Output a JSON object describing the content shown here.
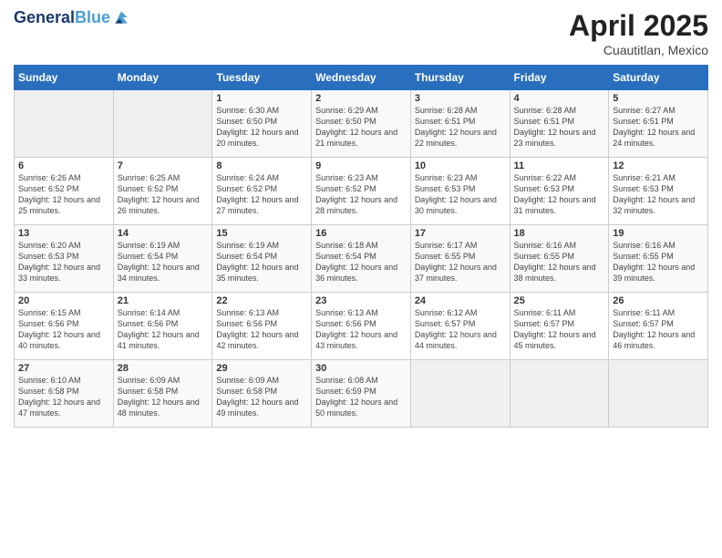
{
  "header": {
    "logo_line1": "General",
    "logo_line2": "Blue",
    "month": "April 2025",
    "location": "Cuautitlan, Mexico"
  },
  "days_of_week": [
    "Sunday",
    "Monday",
    "Tuesday",
    "Wednesday",
    "Thursday",
    "Friday",
    "Saturday"
  ],
  "weeks": [
    [
      {
        "day": "",
        "empty": true
      },
      {
        "day": "",
        "empty": true
      },
      {
        "day": "1",
        "sunrise": "6:30 AM",
        "sunset": "6:50 PM",
        "daylight": "12 hours and 20 minutes."
      },
      {
        "day": "2",
        "sunrise": "6:29 AM",
        "sunset": "6:50 PM",
        "daylight": "12 hours and 21 minutes."
      },
      {
        "day": "3",
        "sunrise": "6:28 AM",
        "sunset": "6:51 PM",
        "daylight": "12 hours and 22 minutes."
      },
      {
        "day": "4",
        "sunrise": "6:28 AM",
        "sunset": "6:51 PM",
        "daylight": "12 hours and 23 minutes."
      },
      {
        "day": "5",
        "sunrise": "6:27 AM",
        "sunset": "6:51 PM",
        "daylight": "12 hours and 24 minutes."
      }
    ],
    [
      {
        "day": "6",
        "sunrise": "6:26 AM",
        "sunset": "6:52 PM",
        "daylight": "12 hours and 25 minutes."
      },
      {
        "day": "7",
        "sunrise": "6:25 AM",
        "sunset": "6:52 PM",
        "daylight": "12 hours and 26 minutes."
      },
      {
        "day": "8",
        "sunrise": "6:24 AM",
        "sunset": "6:52 PM",
        "daylight": "12 hours and 27 minutes."
      },
      {
        "day": "9",
        "sunrise": "6:23 AM",
        "sunset": "6:52 PM",
        "daylight": "12 hours and 28 minutes."
      },
      {
        "day": "10",
        "sunrise": "6:23 AM",
        "sunset": "6:53 PM",
        "daylight": "12 hours and 30 minutes."
      },
      {
        "day": "11",
        "sunrise": "6:22 AM",
        "sunset": "6:53 PM",
        "daylight": "12 hours and 31 minutes."
      },
      {
        "day": "12",
        "sunrise": "6:21 AM",
        "sunset": "6:53 PM",
        "daylight": "12 hours and 32 minutes."
      }
    ],
    [
      {
        "day": "13",
        "sunrise": "6:20 AM",
        "sunset": "6:53 PM",
        "daylight": "12 hours and 33 minutes."
      },
      {
        "day": "14",
        "sunrise": "6:19 AM",
        "sunset": "6:54 PM",
        "daylight": "12 hours and 34 minutes."
      },
      {
        "day": "15",
        "sunrise": "6:19 AM",
        "sunset": "6:54 PM",
        "daylight": "12 hours and 35 minutes."
      },
      {
        "day": "16",
        "sunrise": "6:18 AM",
        "sunset": "6:54 PM",
        "daylight": "12 hours and 36 minutes."
      },
      {
        "day": "17",
        "sunrise": "6:17 AM",
        "sunset": "6:55 PM",
        "daylight": "12 hours and 37 minutes."
      },
      {
        "day": "18",
        "sunrise": "6:16 AM",
        "sunset": "6:55 PM",
        "daylight": "12 hours and 38 minutes."
      },
      {
        "day": "19",
        "sunrise": "6:16 AM",
        "sunset": "6:55 PM",
        "daylight": "12 hours and 39 minutes."
      }
    ],
    [
      {
        "day": "20",
        "sunrise": "6:15 AM",
        "sunset": "6:56 PM",
        "daylight": "12 hours and 40 minutes."
      },
      {
        "day": "21",
        "sunrise": "6:14 AM",
        "sunset": "6:56 PM",
        "daylight": "12 hours and 41 minutes."
      },
      {
        "day": "22",
        "sunrise": "6:13 AM",
        "sunset": "6:56 PM",
        "daylight": "12 hours and 42 minutes."
      },
      {
        "day": "23",
        "sunrise": "6:13 AM",
        "sunset": "6:56 PM",
        "daylight": "12 hours and 43 minutes."
      },
      {
        "day": "24",
        "sunrise": "6:12 AM",
        "sunset": "6:57 PM",
        "daylight": "12 hours and 44 minutes."
      },
      {
        "day": "25",
        "sunrise": "6:11 AM",
        "sunset": "6:57 PM",
        "daylight": "12 hours and 45 minutes."
      },
      {
        "day": "26",
        "sunrise": "6:11 AM",
        "sunset": "6:57 PM",
        "daylight": "12 hours and 46 minutes."
      }
    ],
    [
      {
        "day": "27",
        "sunrise": "6:10 AM",
        "sunset": "6:58 PM",
        "daylight": "12 hours and 47 minutes."
      },
      {
        "day": "28",
        "sunrise": "6:09 AM",
        "sunset": "6:58 PM",
        "daylight": "12 hours and 48 minutes."
      },
      {
        "day": "29",
        "sunrise": "6:09 AM",
        "sunset": "6:58 PM",
        "daylight": "12 hours and 49 minutes."
      },
      {
        "day": "30",
        "sunrise": "6:08 AM",
        "sunset": "6:59 PM",
        "daylight": "12 hours and 50 minutes."
      },
      {
        "day": "",
        "empty": true
      },
      {
        "day": "",
        "empty": true
      },
      {
        "day": "",
        "empty": true
      }
    ]
  ],
  "labels": {
    "sunrise_prefix": "Sunrise: ",
    "sunset_prefix": "Sunset: ",
    "daylight_prefix": "Daylight: "
  }
}
